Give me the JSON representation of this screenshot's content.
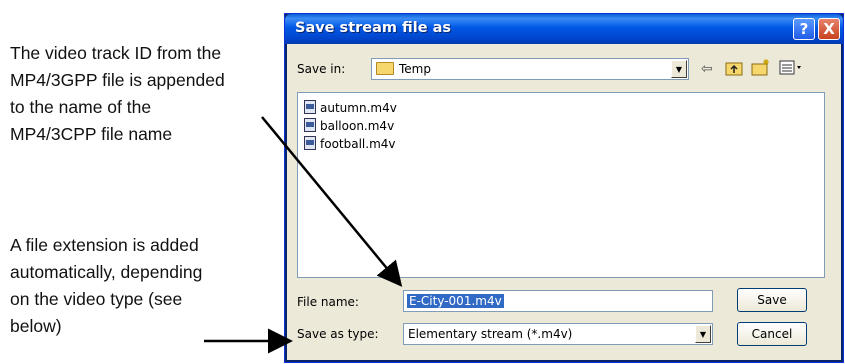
{
  "annotations": {
    "track_id_note": [
      "The video track ID from the",
      "MP4/3GPP file is appended",
      "to the name of the",
      "MP4/3CPP file name"
    ],
    "extension_note": [
      "A file extension is added",
      "automatically, depending",
      "on the video type (see",
      "below)"
    ]
  },
  "dialog": {
    "title": "Save stream file as",
    "help_label": "?",
    "close_label": "X",
    "save_in_label": "Save in:",
    "save_in_value": "Temp",
    "files": [
      "autumn.m4v",
      "balloon.m4v",
      "football.m4v"
    ],
    "file_name_label": "File name:",
    "file_name_value": "E-City-001.m4v",
    "save_as_type_label": "Save as type:",
    "save_as_type_value": "Elementary stream (*.m4v)",
    "save_button": "Save",
    "cancel_button": "Cancel",
    "toolbar_icons": [
      "back-arrow-icon",
      "up-folder-icon",
      "new-folder-icon",
      "view-menu-icon"
    ]
  },
  "colors": {
    "titlebar": "#0058e6",
    "dialog_bg": "#ece9d8",
    "selection": "#316ac5"
  }
}
